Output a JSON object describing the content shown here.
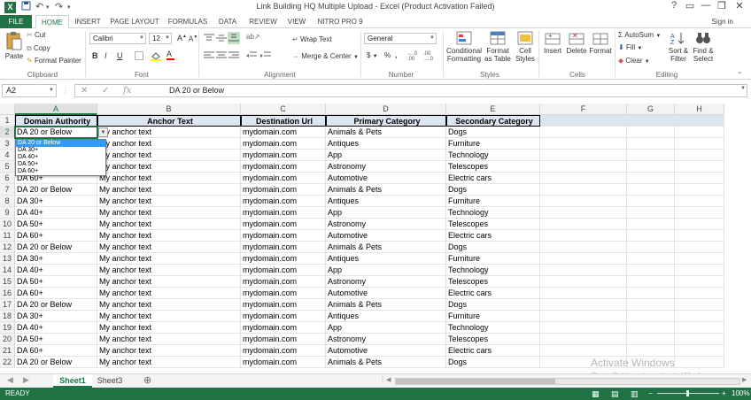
{
  "window": {
    "title": "Link Building HQ Multiple Upload - Excel (Product Activation Failed)",
    "controls": [
      "?",
      "▭",
      "—",
      "❐",
      "✕"
    ]
  },
  "tabs": [
    "FILE",
    "HOME",
    "INSERT",
    "PAGE LAYOUT",
    "FORMULAS",
    "DATA",
    "REVIEW",
    "VIEW",
    "NITRO PRO 9"
  ],
  "signin": "Sign in",
  "ribbon": {
    "clipboard": {
      "label": "Clipboard",
      "paste": "Paste",
      "cut": "Cut",
      "copy": "Copy",
      "format_painter": "Format Painter"
    },
    "font": {
      "label": "Font",
      "font_name": "Calibri",
      "font_size": "12",
      "bold": "B",
      "italic": "I",
      "underline": "U",
      "grow": "A",
      "shrink": "A"
    },
    "alignment": {
      "label": "Alignment",
      "wrap": "Wrap Text",
      "merge": "Merge & Center"
    },
    "number": {
      "label": "Number",
      "format": "General",
      "currency": "$",
      "percent": "%",
      "comma": ","
    },
    "styles": {
      "label": "Styles",
      "conditional": "Conditional Formatting",
      "format_as_table": "Format as Table",
      "cell_styles": "Cell Styles"
    },
    "cells": {
      "label": "Cells",
      "insert": "Insert",
      "delete": "Delete",
      "format": "Format"
    },
    "editing": {
      "label": "Editing",
      "autosum": "AutoSum",
      "fill": "Fill",
      "clear": "Clear",
      "sort": "Sort & Filter",
      "find": "Find & Select"
    }
  },
  "formula_bar": {
    "name_box": "A2",
    "value": "DA 20 or Below"
  },
  "columns": [
    "A",
    "B",
    "C",
    "D",
    "E",
    "F",
    "G",
    "H"
  ],
  "headers": [
    "Domain Authority",
    "Anchor Text",
    "Destination Url",
    "Primary Category",
    "Secondary Category"
  ],
  "rows": [
    [
      "DA 20 or Below",
      "My anchor text",
      "mydomain.com",
      "Animals & Pets",
      "Dogs"
    ],
    [
      "DA 30+",
      "My anchor text",
      "mydomain.com",
      "Antiques",
      "Furniture"
    ],
    [
      "DA 40+",
      "My anchor text",
      "mydomain.com",
      "App",
      "Technology"
    ],
    [
      "DA 50+",
      "My anchor text",
      "mydomain.com",
      "Astronomy",
      "Telescopes"
    ],
    [
      "DA 60+",
      "My anchor text",
      "mydomain.com",
      "Automotive",
      "Electric cars"
    ],
    [
      "DA 20 or Below",
      "My anchor text",
      "mydomain.com",
      "Animals & Pets",
      "Dogs"
    ],
    [
      "DA 30+",
      "My anchor text",
      "mydomain.com",
      "Antiques",
      "Furniture"
    ],
    [
      "DA 40+",
      "My anchor text",
      "mydomain.com",
      "App",
      "Technology"
    ],
    [
      "DA 50+",
      "My anchor text",
      "mydomain.com",
      "Astronomy",
      "Telescopes"
    ],
    [
      "DA 60+",
      "My anchor text",
      "mydomain.com",
      "Automotive",
      "Electric cars"
    ],
    [
      "DA 20 or Below",
      "My anchor text",
      "mydomain.com",
      "Animals & Pets",
      "Dogs"
    ],
    [
      "DA 30+",
      "My anchor text",
      "mydomain.com",
      "Antiques",
      "Furniture"
    ],
    [
      "DA 40+",
      "My anchor text",
      "mydomain.com",
      "App",
      "Technology"
    ],
    [
      "DA 50+",
      "My anchor text",
      "mydomain.com",
      "Astronomy",
      "Telescopes"
    ],
    [
      "DA 60+",
      "My anchor text",
      "mydomain.com",
      "Automotive",
      "Electric cars"
    ],
    [
      "DA 20 or Below",
      "My anchor text",
      "mydomain.com",
      "Animals & Pets",
      "Dogs"
    ],
    [
      "DA 30+",
      "My anchor text",
      "mydomain.com",
      "Antiques",
      "Furniture"
    ],
    [
      "DA 40+",
      "My anchor text",
      "mydomain.com",
      "App",
      "Technology"
    ],
    [
      "DA 50+",
      "My anchor text",
      "mydomain.com",
      "Astronomy",
      "Telescopes"
    ],
    [
      "DA 60+",
      "My anchor text",
      "mydomain.com",
      "Automotive",
      "Electric cars"
    ],
    [
      "DA 20 or Below",
      "My anchor text",
      "mydomain.com",
      "Animals & Pets",
      "Dogs"
    ]
  ],
  "dropdown_options": [
    "DA 20 or Below",
    "DA 30+",
    "DA 40+",
    "DA 50+",
    "DA 60+"
  ],
  "dropdown_selected": "DA 20 or Below",
  "sheets": [
    "Sheet1",
    "Sheet3"
  ],
  "active_sheet": "Sheet1",
  "status": {
    "mode": "READY",
    "zoom": "100%"
  },
  "watermark": {
    "line1": "Activate Windows",
    "line2": "Go to Settings to activate Windows."
  },
  "colors": {
    "excel_green": "#217346",
    "header_fill": "#dce6f1",
    "selection_blue": "#3399ff"
  }
}
